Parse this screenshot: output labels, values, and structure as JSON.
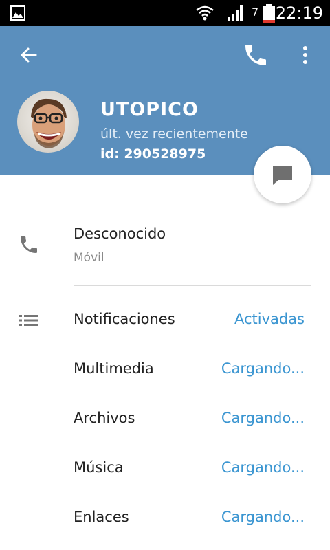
{
  "status_bar": {
    "battery_level": "7",
    "time": "22:19",
    "icons": [
      "gallery-icon",
      "wifi-icon",
      "signal-icon",
      "battery-icon"
    ]
  },
  "header": {
    "background_color": "#5b8fbd",
    "name": "UTOPICO",
    "status": "últ. vez recientemente",
    "user_id": "id: 290528975"
  },
  "phone": {
    "number": "Desconocido",
    "type": "Móvil"
  },
  "settings": [
    {
      "label": "Notificaciones",
      "value": "Activadas"
    },
    {
      "label": "Multimedia",
      "value": "Cargando..."
    },
    {
      "label": "Archivos",
      "value": "Cargando..."
    },
    {
      "label": "Música",
      "value": "Cargando..."
    },
    {
      "label": "Enlaces",
      "value": "Cargando..."
    }
  ],
  "colors": {
    "accent": "#3a95d1",
    "primary_text": "#222222",
    "secondary_text": "#8a8a8a"
  }
}
